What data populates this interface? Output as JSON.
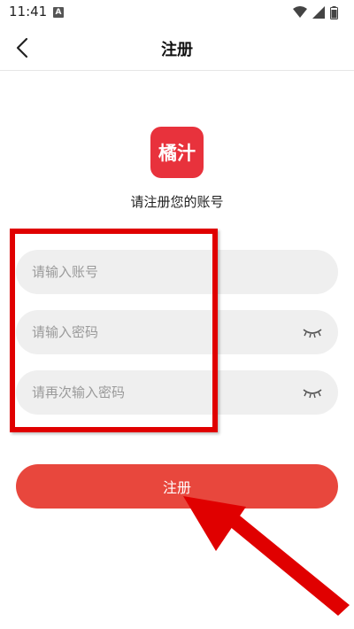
{
  "status_bar": {
    "time": "11:41",
    "notification_badge": "A"
  },
  "header": {
    "title": "注册"
  },
  "logo": {
    "text": "橘汁",
    "color": "#e8323c"
  },
  "subtitle": "请注册您的账号",
  "form": {
    "account_placeholder": "请输入账号",
    "password_placeholder": "请输入密码",
    "confirm_placeholder": "请再次输入密码"
  },
  "register_button": {
    "label": "注册",
    "color": "#e8473d"
  },
  "annotation": {
    "highlight_color": "#e00000"
  }
}
